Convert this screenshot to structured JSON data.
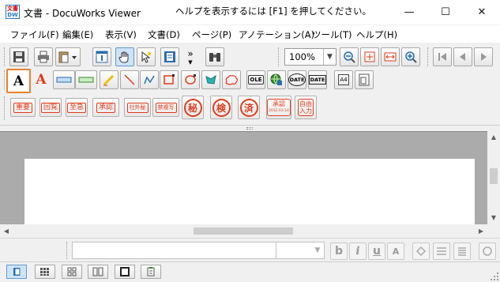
{
  "window": {
    "title": "文書 - DocuWorks Viewer",
    "app_icon_top": "DW",
    "app_icon_bottom": "文書",
    "minimize_glyph": "—",
    "maximize_glyph": "☐",
    "close_glyph": "✕"
  },
  "menu": {
    "items": [
      "ファイル(F)",
      "編集(E)",
      "表示(V)",
      "文書(D)",
      "ページ(P)",
      "アノテーション(A)",
      "ツール(T)",
      "ヘルプ(H)"
    ]
  },
  "toolbar": {
    "zoom_value": "100%",
    "more_glyph": "»",
    "icons": [
      "save-icon",
      "print-icon",
      "paste-icon",
      "properties-icon",
      "hand-tool-icon",
      "select-tool-icon",
      "thumbnail-icon",
      "binoculars-icon",
      "zoom-out-icon",
      "fit-page-icon",
      "fit-width-icon",
      "zoom-in-icon",
      "first-page-icon",
      "previous-page-icon",
      "next-page-icon"
    ]
  },
  "annotation_bar": {
    "text_a_black": "A",
    "text_a_red": "A",
    "date_label": "DATE",
    "ole_label": "OLE",
    "size_label": "A4"
  },
  "stamps": {
    "labels": [
      "重要",
      "回覧",
      "至急",
      "承認",
      "社外秘",
      "禁複写"
    ],
    "circles": [
      "秘",
      "検",
      "済"
    ],
    "approved_label": "承認",
    "approved_date": "2012.03.14",
    "free_input_line1": "自由",
    "free_input_line2": "入力"
  },
  "format_bar": {
    "bold": "b",
    "italic": "i",
    "underline": "u",
    "font_a": "A"
  },
  "status": {
    "help_text": "ヘルプを表示するには [F1] を押してください。"
  },
  "colors": {
    "stamp_red": "#e03c1c",
    "selection_orange": "#e8812b",
    "workspace_gray": "#ababab"
  }
}
